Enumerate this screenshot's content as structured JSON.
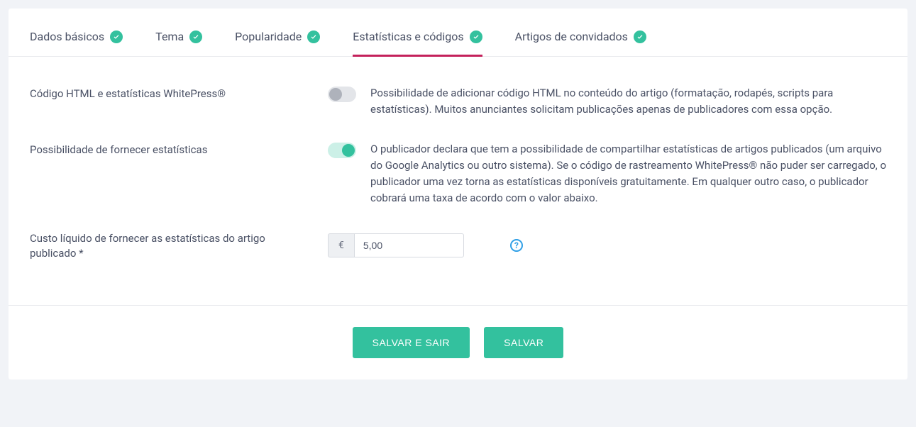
{
  "tabs": [
    {
      "label": "Dados básicos",
      "active": false
    },
    {
      "label": "Tema",
      "active": false
    },
    {
      "label": "Popularidade",
      "active": false
    },
    {
      "label": "Estatísticas e códigos",
      "active": true
    },
    {
      "label": "Artigos de convidados",
      "active": false
    }
  ],
  "fields": {
    "html_code": {
      "label": "Código HTML e estatísticas WhitePress®",
      "toggle_on": false,
      "description": "Possibilidade de adicionar código HTML no conteúdo do artigo (formatação, rodapés, scripts para estatísticas). Muitos anunciantes solicitam publicações apenas de publicadores com essa opção."
    },
    "provide_stats": {
      "label": "Possibilidade de fornecer estatísticas",
      "toggle_on": true,
      "description": "O publicador declara que tem a possibilidade de compartilhar estatísticas de artigos publicados (um arquivo do Google Analytics ou outro sistema). Se o código de rastreamento WhitePress® não puder ser carregado, o publicador uma vez torna as estatísticas disponíveis gratuitamente. Em qualquer outro caso, o publicador cobrará uma taxa de acordo com o valor abaixo."
    },
    "net_cost": {
      "label": "Custo líquido de fornecer as estatísticas do artigo publicado *",
      "currency": "€",
      "value": "5,00"
    }
  },
  "buttons": {
    "save_exit": "SALVAR E SAIR",
    "save": "SALVAR"
  }
}
